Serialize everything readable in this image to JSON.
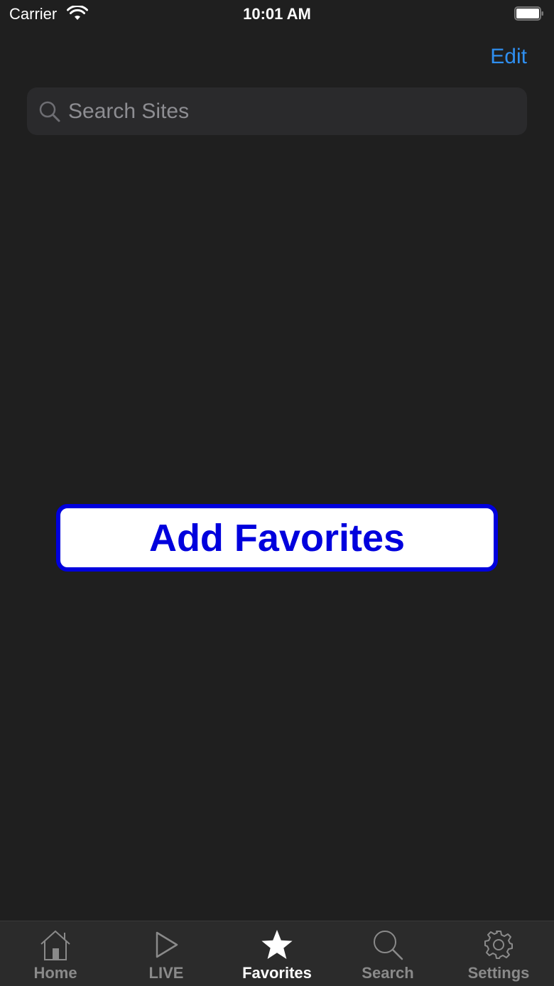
{
  "status_bar": {
    "carrier": "Carrier",
    "time": "10:01 AM"
  },
  "nav": {
    "edit_label": "Edit"
  },
  "search": {
    "placeholder": "Search Sites",
    "value": ""
  },
  "main": {
    "add_favorites_label": "Add Favorites"
  },
  "tab_bar": {
    "items": [
      {
        "label": "Home",
        "icon": "home-icon",
        "active": false
      },
      {
        "label": "LIVE",
        "icon": "play-icon",
        "active": false
      },
      {
        "label": "Favorites",
        "icon": "star-icon",
        "active": true
      },
      {
        "label": "Search",
        "icon": "search-icon",
        "active": false
      },
      {
        "label": "Settings",
        "icon": "gear-icon",
        "active": false
      }
    ]
  },
  "colors": {
    "background": "#1f1f1f",
    "accent": "#2f8ff0",
    "button_border": "#0000dd",
    "tab_inactive": "#8a8a8a",
    "tab_active": "#ffffff"
  }
}
